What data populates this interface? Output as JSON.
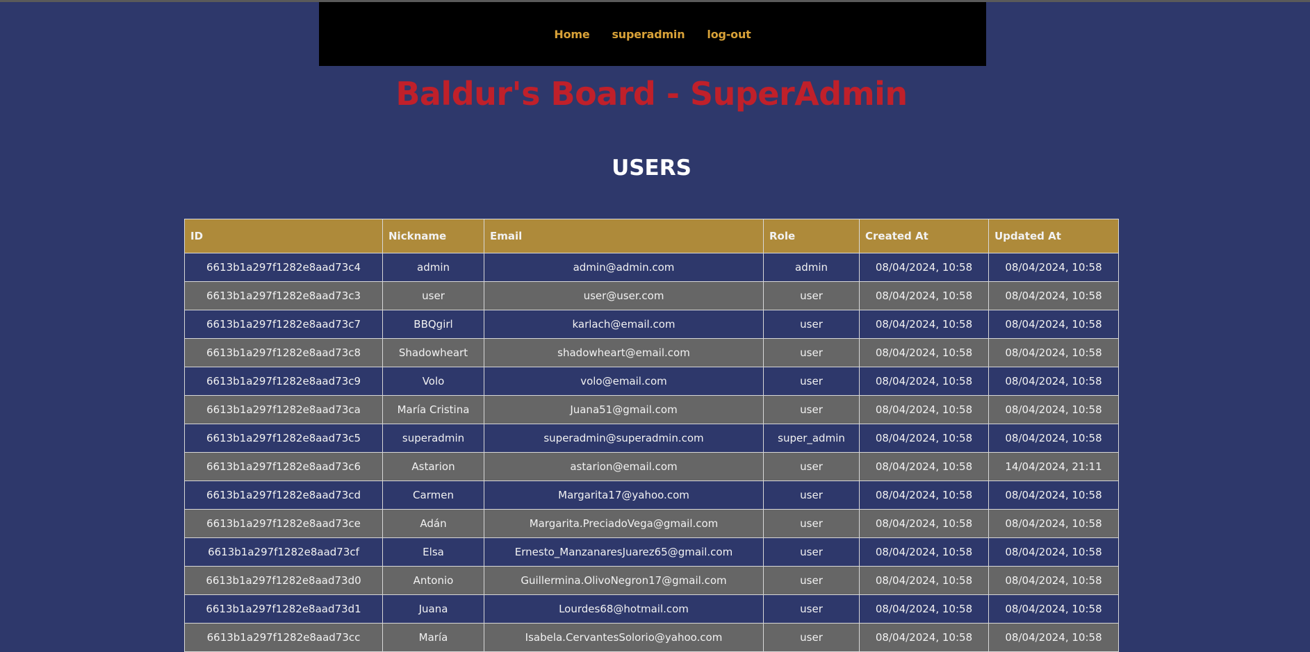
{
  "nav": {
    "links": [
      "Home",
      "superadmin",
      "log-out"
    ]
  },
  "site_title": "Baldur's Board - SuperAdmin",
  "section_title": "USERS",
  "table": {
    "headers": [
      "ID",
      "Nickname",
      "Email",
      "Role",
      "Created At",
      "Updated At"
    ],
    "rows": [
      [
        "6613b1a297f1282e8aad73c4",
        "admin",
        "admin@admin.com",
        "admin",
        "08/04/2024, 10:58",
        "08/04/2024, 10:58"
      ],
      [
        "6613b1a297f1282e8aad73c3",
        "user",
        "user@user.com",
        "user",
        "08/04/2024, 10:58",
        "08/04/2024, 10:58"
      ],
      [
        "6613b1a297f1282e8aad73c7",
        "BBQgirl",
        "karlach@email.com",
        "user",
        "08/04/2024, 10:58",
        "08/04/2024, 10:58"
      ],
      [
        "6613b1a297f1282e8aad73c8",
        "Shadowheart",
        "shadowheart@email.com",
        "user",
        "08/04/2024, 10:58",
        "08/04/2024, 10:58"
      ],
      [
        "6613b1a297f1282e8aad73c9",
        "Volo",
        "volo@email.com",
        "user",
        "08/04/2024, 10:58",
        "08/04/2024, 10:58"
      ],
      [
        "6613b1a297f1282e8aad73ca",
        "María Cristina",
        "Juana51@gmail.com",
        "user",
        "08/04/2024, 10:58",
        "08/04/2024, 10:58"
      ],
      [
        "6613b1a297f1282e8aad73c5",
        "superadmin",
        "superadmin@superadmin.com",
        "super_admin",
        "08/04/2024, 10:58",
        "08/04/2024, 10:58"
      ],
      [
        "6613b1a297f1282e8aad73c6",
        "Astarion",
        "astarion@email.com",
        "user",
        "08/04/2024, 10:58",
        "14/04/2024, 21:11"
      ],
      [
        "6613b1a297f1282e8aad73cd",
        "Carmen",
        "Margarita17@yahoo.com",
        "user",
        "08/04/2024, 10:58",
        "08/04/2024, 10:58"
      ],
      [
        "6613b1a297f1282e8aad73ce",
        "Adán",
        "Margarita.PreciadoVega@gmail.com",
        "user",
        "08/04/2024, 10:58",
        "08/04/2024, 10:58"
      ],
      [
        "6613b1a297f1282e8aad73cf",
        "Elsa",
        "Ernesto_ManzanaresJuarez65@gmail.com",
        "user",
        "08/04/2024, 10:58",
        "08/04/2024, 10:58"
      ],
      [
        "6613b1a297f1282e8aad73d0",
        "Antonio",
        "Guillermina.OlivoNegron17@gmail.com",
        "user",
        "08/04/2024, 10:58",
        "08/04/2024, 10:58"
      ],
      [
        "6613b1a297f1282e8aad73d1",
        "Juana",
        "Lourdes68@hotmail.com",
        "user",
        "08/04/2024, 10:58",
        "08/04/2024, 10:58"
      ],
      [
        "6613b1a297f1282e8aad73cc",
        "María",
        "Isabela.CervantesSolorio@yahoo.com",
        "user",
        "08/04/2024, 10:58",
        "08/04/2024, 10:58"
      ]
    ]
  }
}
